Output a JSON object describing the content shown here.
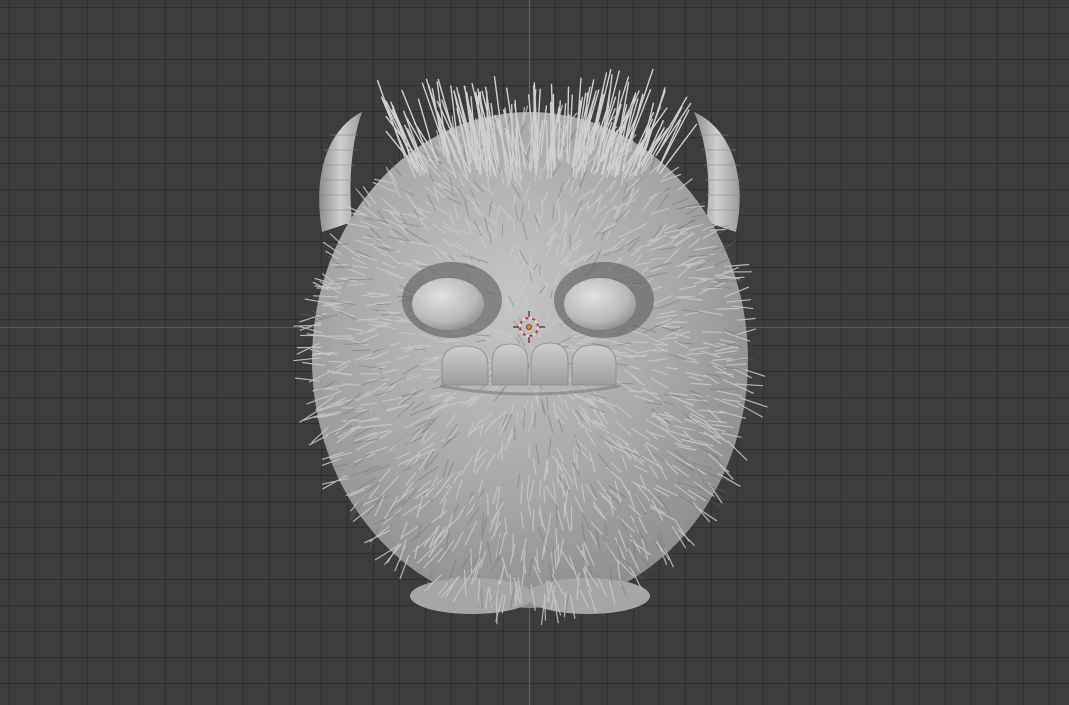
{
  "viewport": {
    "name": "3D Viewport",
    "background_color": "#3d3d3d",
    "grid_color": "#333333",
    "axis_x_color": "#9b3b45",
    "axis_z_color": "#3d6fa6"
  },
  "scene": {
    "object": "furry-monster-model",
    "fur_color": "#bdbdbd",
    "body_color": "#a9a9a9",
    "horn_color": "#b3b3b3"
  },
  "cursor": {
    "icon": "3d-cursor-icon",
    "ring_colors": [
      "#d9d9d9",
      "#c0392b"
    ],
    "center_color": "#e08a2a"
  }
}
